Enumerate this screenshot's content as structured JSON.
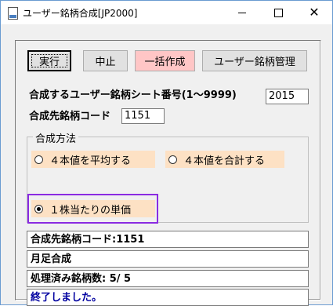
{
  "window": {
    "title": "ユーザー銘柄合成[JP2000]"
  },
  "toolbar": {
    "exec_label": "実行",
    "stop_label": "中止",
    "bulk_label": "一括作成",
    "manage_label": "ユーザー銘柄管理"
  },
  "form": {
    "sheet_label": "合成するユーザー銘柄シート番号(1～9999)",
    "sheet_value": "2015",
    "code_label": "合成先銘柄コード",
    "code_value": "1151"
  },
  "method": {
    "title": "合成方法",
    "options": [
      {
        "label": "４本値を平均する",
        "checked": false
      },
      {
        "label": "４本値を合計する",
        "checked": false
      },
      {
        "label": "１株当たりの単価",
        "checked": true
      }
    ]
  },
  "status": {
    "line1": "合成先銘柄コード:1151",
    "line2": "月足合成",
    "line3": "処理済み銘柄数: 5/ 5",
    "line4": "終了しました。"
  },
  "colors": {
    "bulk_button": "#ffc6c6",
    "radio_bg": "#fde1c4",
    "highlight_outline": "#8a2be2",
    "done_text": "#0000a0"
  }
}
